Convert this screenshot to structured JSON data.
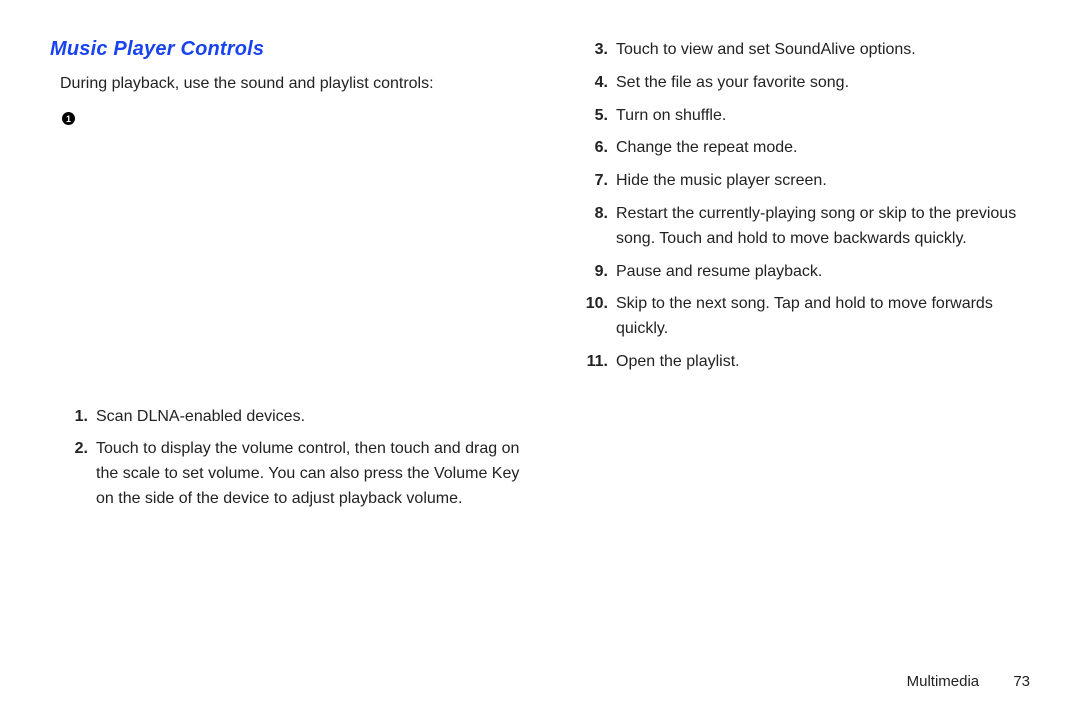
{
  "heading": "Music Player Controls",
  "intro": "During playback, use the sound and playlist controls:",
  "marker": "1",
  "left_items": [
    {
      "n": "1.",
      "t": "Scan DLNA-enabled devices."
    },
    {
      "n": "2.",
      "t": "Touch to display the volume control, then touch and drag on the scale to set volume. You can also press the Volume Key on the side of the device to adjust playback volume."
    }
  ],
  "right_items": [
    {
      "n": "3.",
      "t": "Touch to view and set SoundAlive options."
    },
    {
      "n": "4.",
      "t": "Set the file as your favorite song."
    },
    {
      "n": "5.",
      "t": "Turn on shuffle."
    },
    {
      "n": "6.",
      "t": "Change the repeat mode."
    },
    {
      "n": "7.",
      "t": "Hide the music player screen."
    },
    {
      "n": "8.",
      "t": "Restart the currently-playing song or skip to the previous song. Touch and hold to move backwards quickly."
    },
    {
      "n": "9.",
      "t": "Pause and resume playback."
    },
    {
      "n": "10.",
      "t": "Skip to the next song. Tap and hold to move forwards quickly."
    },
    {
      "n": "11.",
      "t": "Open the playlist."
    }
  ],
  "footer": {
    "section": "Multimedia",
    "page": "73"
  }
}
